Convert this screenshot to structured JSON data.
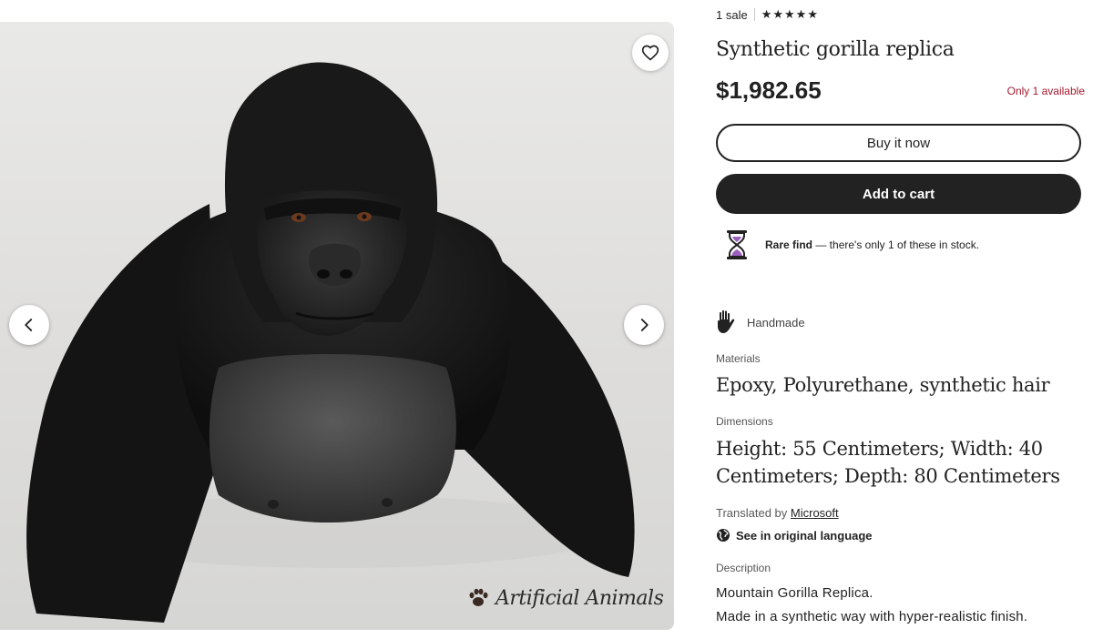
{
  "gallery": {
    "watermark_text": "Artificial Animals",
    "icons": {
      "favorite": "heart-outline-icon",
      "prev": "chevron-left-icon",
      "next": "chevron-right-icon",
      "watermark": "paw-print-icon"
    }
  },
  "listing": {
    "sales": "1 sale",
    "rating_stars": "★★★★★",
    "rating": 5,
    "title": "Synthetic gorilla replica",
    "price": "$1,982.65",
    "availability": "Only 1 available",
    "buy_now_label": "Buy it now",
    "add_to_cart_label": "Add to cart",
    "rare_find": {
      "bold": "Rare find",
      "text": " — there's only 1 of these in stock.",
      "icon": "hourglass-icon"
    },
    "handmade_label": "Handmade",
    "handmade_icon": "hand-icon",
    "materials_label": "Materials",
    "materials_value": "Epoxy, Polyurethane, synthetic hair",
    "dimensions_label": "Dimensions",
    "dimensions_value": "Height: 55 Centimeters; Width: 40 Centimeters; Depth: 80 Centimeters",
    "translated_prefix": "Translated by ",
    "translated_by": "Microsoft",
    "original_language_label": "See in original language",
    "original_language_icon": "globe-icon",
    "description_label": "Description",
    "description_lines": [
      "Mountain Gorilla Replica.",
      "Made in a synthetic way with hyper-realistic finish."
    ]
  },
  "colors": {
    "primary_dark": "#222222",
    "availability_red": "#a61a2e",
    "hourglass_purple": "#9b5fc0"
  }
}
